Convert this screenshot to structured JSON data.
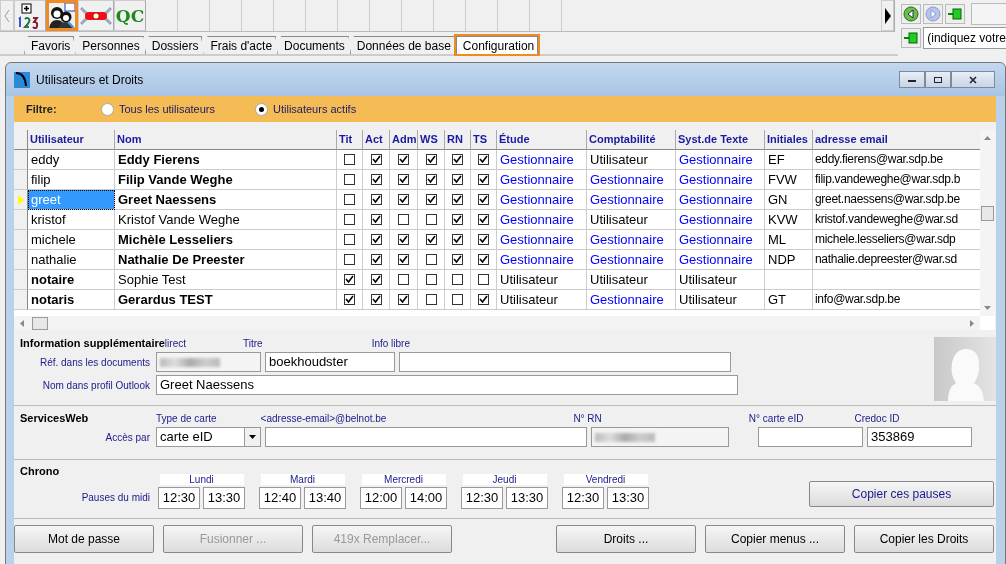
{
  "toolbar": {
    "buttons": [
      {
        "kind": "numbers",
        "selected": false
      },
      {
        "kind": "users",
        "selected": true
      },
      {
        "kind": "tool",
        "selected": false
      },
      {
        "kind": "qc",
        "label": "QC",
        "selected": false
      }
    ]
  },
  "nav": {
    "value": "(indiquez votre"
  },
  "tabs": [
    {
      "label": "Favoris",
      "selected": false
    },
    {
      "label": "Personnes",
      "selected": false
    },
    {
      "label": "Dossiers",
      "selected": false
    },
    {
      "label": "Frais d'acte",
      "selected": false
    },
    {
      "label": "Documents",
      "selected": false
    },
    {
      "label": "Données de base",
      "selected": false
    },
    {
      "label": "Configuration",
      "selected": true
    }
  ],
  "window": {
    "title": "Utilisateurs et Droits"
  },
  "filter": {
    "label": "Filtre:",
    "options": [
      {
        "label": "Tous les utilisateurs",
        "selected": false
      },
      {
        "label": "Utilisateurs actifs",
        "selected": true
      }
    ]
  },
  "grid": {
    "columns": [
      "Utilisateur",
      "Nom",
      "Tit",
      "Act",
      "Adm",
      "WS",
      "RN",
      "TS",
      "Étude",
      "Comptabilité",
      "Syst.de Texte",
      "Initiales",
      "adresse email"
    ],
    "rows": [
      {
        "user": "eddy",
        "user_bold": false,
        "name": "Eddy Fierens",
        "name_bold": true,
        "selected": false,
        "flags": [
          false,
          true,
          true,
          true,
          true,
          true
        ],
        "roles": [
          {
            "text": "Gestionnaire",
            "color": "#0000ff"
          },
          {
            "text": "Utilisateur",
            "color": "#000000"
          },
          {
            "text": "Gestionnaire",
            "color": "#0000ff"
          }
        ],
        "initials": "EF",
        "email": "eddy.fierens@war.sdp.be"
      },
      {
        "user": "filip",
        "user_bold": false,
        "name": "Filip Vande Weghe",
        "name_bold": true,
        "selected": false,
        "flags": [
          false,
          true,
          true,
          true,
          true,
          true
        ],
        "roles": [
          {
            "text": "Gestionnaire",
            "color": "#0000ff"
          },
          {
            "text": "Gestionnaire",
            "color": "#0000ff"
          },
          {
            "text": "Gestionnaire",
            "color": "#0000ff"
          }
        ],
        "initials": "FVW",
        "email": "filip.vandeweghe@war.sdp.b"
      },
      {
        "user": "greet",
        "user_bold": false,
        "name": "Greet Naessens",
        "name_bold": true,
        "selected": true,
        "flags": [
          false,
          true,
          true,
          true,
          true,
          true
        ],
        "roles": [
          {
            "text": "Gestionnaire",
            "color": "#0000ff"
          },
          {
            "text": "Gestionnaire",
            "color": "#0000ff"
          },
          {
            "text": "Gestionnaire",
            "color": "#0000ff"
          }
        ],
        "initials": "GN",
        "email": "greet.naessens@war.sdp.be"
      },
      {
        "user": "kristof",
        "user_bold": false,
        "name": "Kristof Vande Weghe",
        "name_bold": false,
        "selected": false,
        "flags": [
          false,
          true,
          false,
          false,
          true,
          true
        ],
        "roles": [
          {
            "text": "Gestionnaire",
            "color": "#0000ff"
          },
          {
            "text": "Utilisateur",
            "color": "#000000"
          },
          {
            "text": "Gestionnaire",
            "color": "#0000ff"
          }
        ],
        "initials": "KVW",
        "email": "kristof.vandeweghe@war.sd"
      },
      {
        "user": "michele",
        "user_bold": false,
        "name": "Michèle Lesseliers",
        "name_bold": true,
        "selected": false,
        "flags": [
          false,
          true,
          true,
          true,
          true,
          true
        ],
        "roles": [
          {
            "text": "Gestionnaire",
            "color": "#0000ff"
          },
          {
            "text": "Gestionnaire",
            "color": "#0000ff"
          },
          {
            "text": "Gestionnaire",
            "color": "#0000ff"
          }
        ],
        "initials": "ML",
        "email": "michele.lesseliers@war.sdp"
      },
      {
        "user": "nathalie",
        "user_bold": false,
        "name": "Nathalie De Preester",
        "name_bold": true,
        "selected": false,
        "flags": [
          false,
          true,
          true,
          false,
          true,
          true
        ],
        "roles": [
          {
            "text": "Gestionnaire",
            "color": "#0000ff"
          },
          {
            "text": "Gestionnaire",
            "color": "#0000ff"
          },
          {
            "text": "Gestionnaire",
            "color": "#0000ff"
          }
        ],
        "initials": "NDP",
        "email": "nathalie.depreester@war.sd"
      },
      {
        "user": "notaire",
        "user_bold": true,
        "name": "Sophie Test",
        "name_bold": false,
        "selected": false,
        "flags": [
          true,
          true,
          false,
          false,
          false,
          false
        ],
        "roles": [
          {
            "text": "Utilisateur",
            "color": "#000000"
          },
          {
            "text": "Utilisateur",
            "color": "#000000"
          },
          {
            "text": "Utilisateur",
            "color": "#000000"
          }
        ]
      },
      {
        "user": "notaris",
        "user_bold": true,
        "name": "Gerardus TEST",
        "name_bold": true,
        "selected": false,
        "flags": [
          true,
          true,
          true,
          false,
          false,
          true
        ],
        "roles": [
          {
            "text": "Utilisateur",
            "color": "#000000"
          },
          {
            "text": "Gestionnaire",
            "color": "#0000ff"
          },
          {
            "text": "Utilisateur",
            "color": "#000000"
          }
        ],
        "initials": "GT",
        "email": "info@war.sdp.be"
      }
    ]
  },
  "info": {
    "title": "Information supplémentaire",
    "ref_label": "Réf. dans les documents",
    "field_labels": [
      "lirect",
      "Titre",
      "Info libre"
    ],
    "titre": "boekhoudster",
    "outlook_label": "Nom dans profil Outlook",
    "outlook": "Greet Naessens"
  },
  "services": {
    "title": "ServicesWeb",
    "access_label": "Accès par",
    "type_label": "Type de carte",
    "type_value": "carte eID",
    "email_label": "<adresse-email>@belnot.be",
    "rn_label": "N° RN",
    "eid_label": "N° carte eID",
    "credoc_label": "Credoc ID",
    "credoc_value": "353869"
  },
  "chrono": {
    "title": "Chrono",
    "label": "Pauses du midi",
    "days": [
      {
        "day": "Lundi",
        "start": "12:30",
        "end": "13:30"
      },
      {
        "day": "Mardi",
        "start": "12:40",
        "end": "13:40"
      },
      {
        "day": "Mercredi",
        "start": "12:00",
        "end": "14:00"
      },
      {
        "day": "Jeudi",
        "start": "12:30",
        "end": "13:30"
      },
      {
        "day": "Vendredi",
        "start": "12:30",
        "end": "13:30"
      }
    ],
    "copy_button": "Copier ces pauses"
  },
  "buttons": [
    {
      "label": "Mot de passe",
      "disabled": false
    },
    {
      "label": "Fusionner ...",
      "disabled": true
    },
    {
      "label": "419x Remplacer...",
      "disabled": true
    },
    {
      "label": "Droits ...",
      "disabled": false
    },
    {
      "label": "Copier menus ...",
      "disabled": false
    },
    {
      "label": "Copier les Droits",
      "disabled": false
    }
  ]
}
